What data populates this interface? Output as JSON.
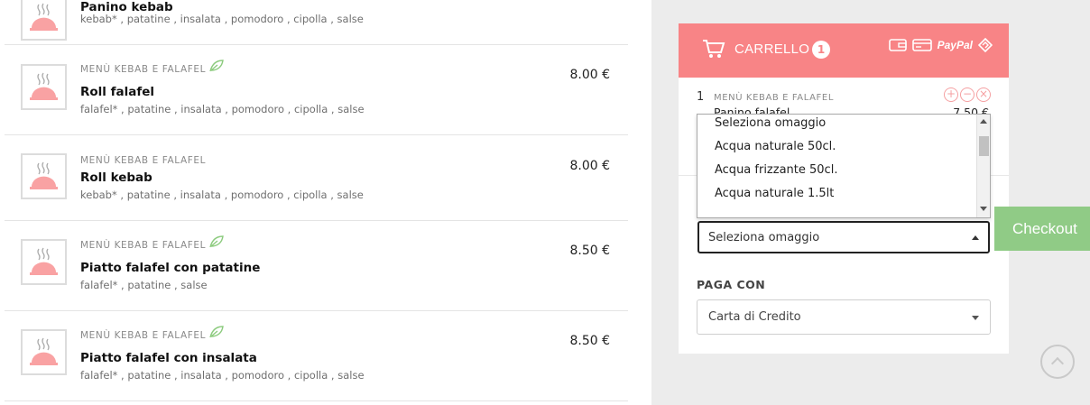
{
  "menu": {
    "items": [
      {
        "category": "",
        "name": "Panino kebab",
        "ingredients": "kebab* , patatine , insalata , pomodoro , cipolla , salse",
        "price": "",
        "veg": false
      },
      {
        "category": "MENÙ KEBAB E FALAFEL",
        "name": "Roll falafel",
        "ingredients": "falafel* , patatine , insalata , pomodoro , cipolla , salse",
        "price": "8.00 €",
        "veg": true
      },
      {
        "category": "MENÙ KEBAB E FALAFEL",
        "name": "Roll kebab",
        "ingredients": "kebab* , patatine , insalata , pomodoro , cipolla , salse",
        "price": "8.00 €",
        "veg": false
      },
      {
        "category": "MENÙ KEBAB E FALAFEL",
        "name": "Piatto falafel con patatine",
        "ingredients": "falafel* , patatine , salse",
        "price": "8.50 €",
        "veg": true
      },
      {
        "category": "MENÙ KEBAB E FALAFEL",
        "name": "Piatto falafel con insalata",
        "ingredients": "falafel* , patatine , insalata , pomodoro , cipolla , salse",
        "price": "8.50 €",
        "veg": true
      }
    ]
  },
  "cart": {
    "title": "CARRELLO",
    "count": "1",
    "paypal_label": "PayPal",
    "line": {
      "qty": "1",
      "category": "MENÙ KEBAB E FALAFEL",
      "name": "Panino falafel",
      "price": "7.50 €"
    },
    "gift_select": {
      "value": "Seleziona omaggio",
      "options": [
        "Seleziona omaggio",
        "Acqua naturale 50cl.",
        "Acqua frizzante 50cl.",
        "Acqua naturale 1.5lt"
      ]
    },
    "pay_label": "PAGA CON",
    "pay_select": {
      "value": "Carta di Credito"
    }
  },
  "checkout_label": "Checkout",
  "colors": {
    "accent": "#f88486",
    "checkout": "#90cb86",
    "leaf": "#8ccb7e",
    "background": "#ececec"
  }
}
